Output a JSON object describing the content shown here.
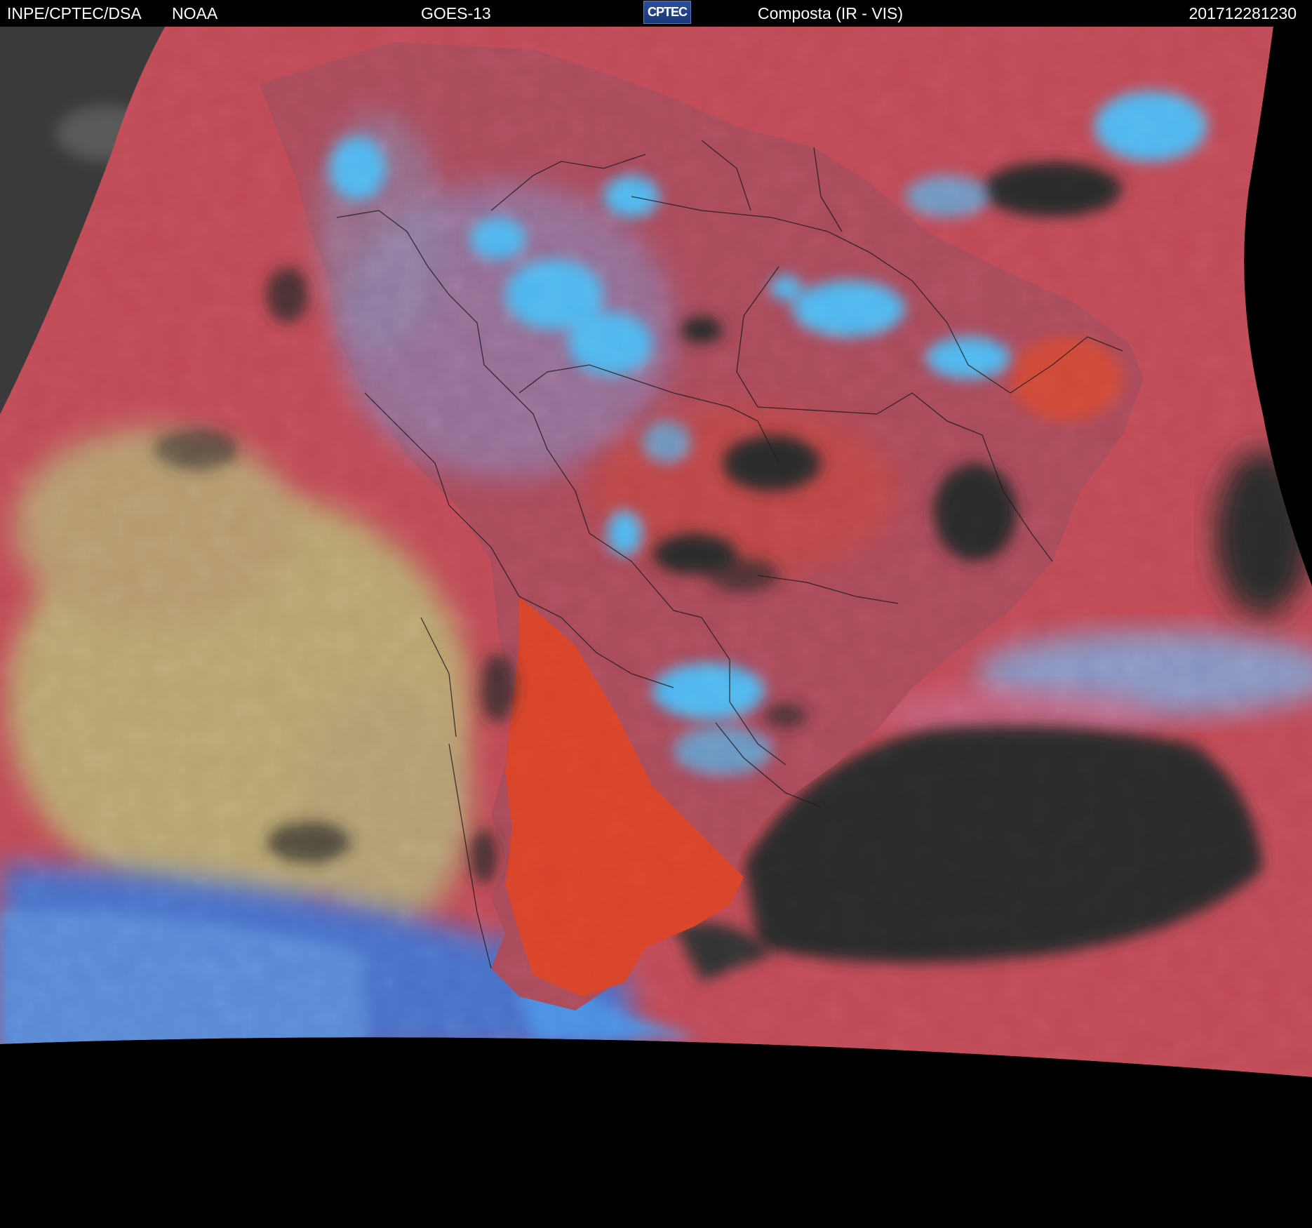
{
  "header": {
    "source": "INPE/CPTEC/DSA",
    "agency": "NOAA",
    "satellite": "GOES-13",
    "logo_text": "CPTEC",
    "product": "Composta (IR - VIS)",
    "timestamp": "201712281230"
  },
  "colors": {
    "background": "#000000",
    "land_red": "#b8454c",
    "ocean_red": "#c04a55",
    "argentina_orange": "#d8432a",
    "high_cloud_cyan": "#4fb6ee",
    "low_cloud_yellow": "#b8a46f",
    "clear_dark": "#2a2a2a",
    "purple_haze": "#8e7aa8",
    "grey_region": "#3a3a3a"
  }
}
